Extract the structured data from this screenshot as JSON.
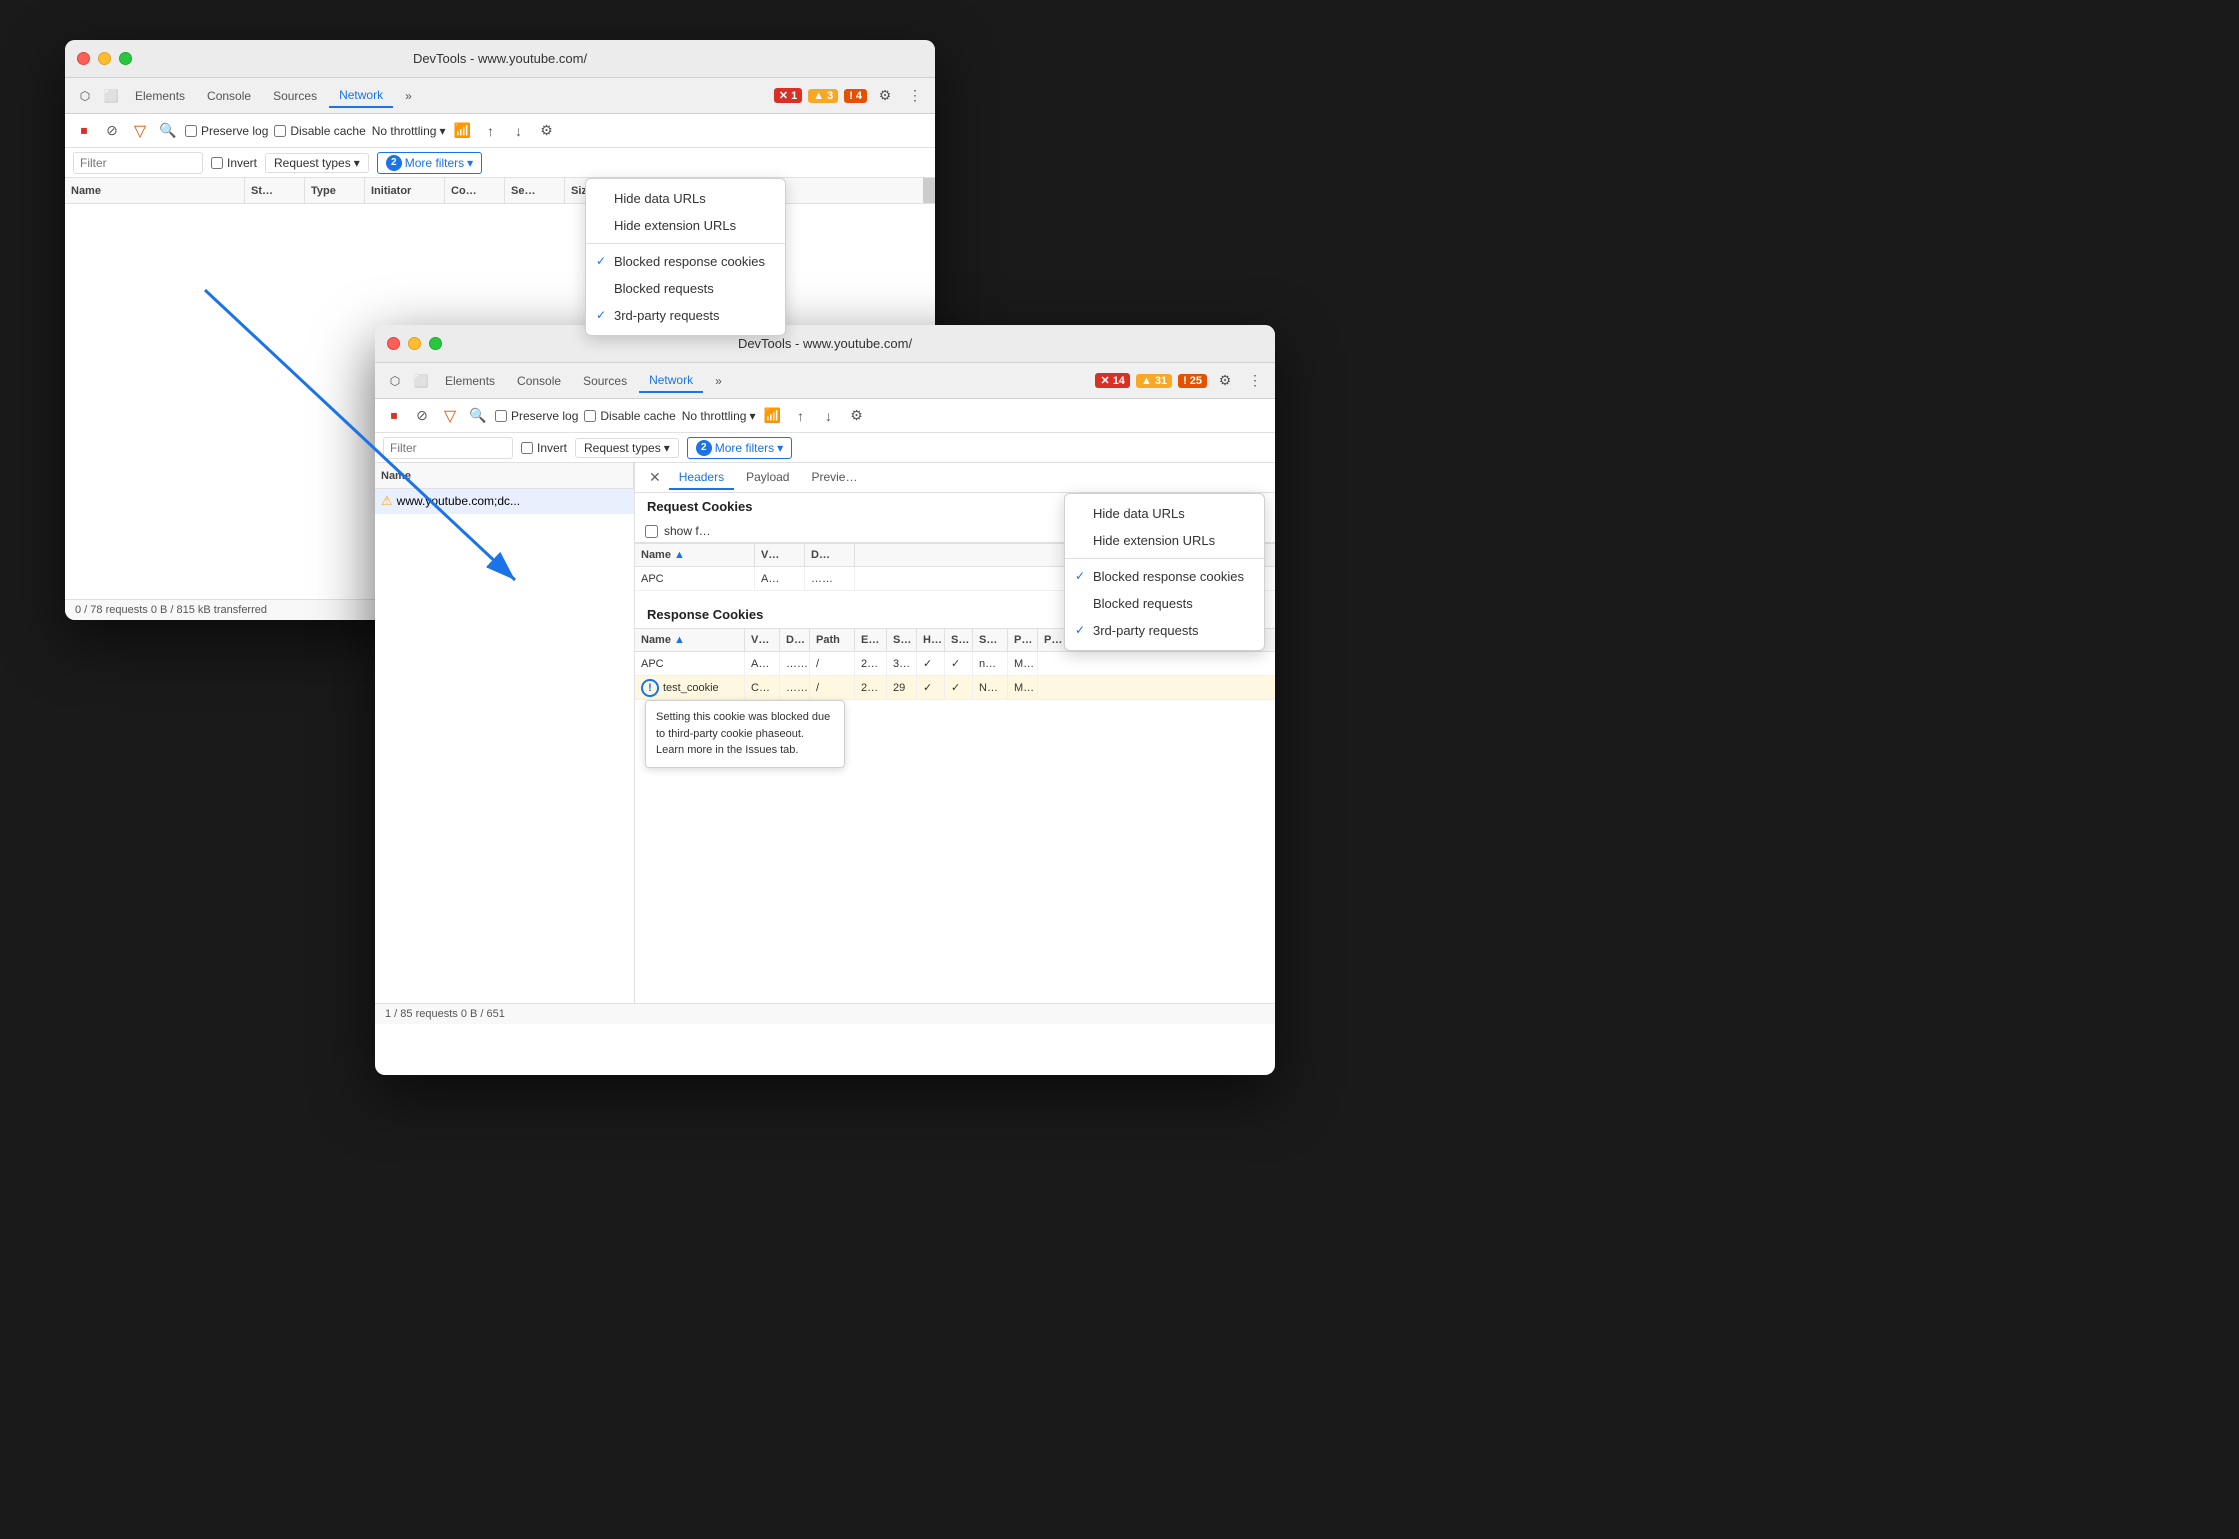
{
  "window1": {
    "title": "DevTools - www.youtube.com/",
    "tabs": [
      "Elements",
      "Console",
      "Sources",
      "Network",
      "»"
    ],
    "active_tab": "Network",
    "badges": [
      {
        "type": "red",
        "icon": "✕",
        "count": "1"
      },
      {
        "type": "yellow",
        "icon": "▲",
        "count": "3"
      },
      {
        "type": "orange",
        "icon": "!",
        "count": "4"
      }
    ],
    "toolbar": {
      "preserve_log": false,
      "disable_cache": false,
      "throttle": "No throttling"
    },
    "filter": {
      "placeholder": "Filter",
      "invert": false,
      "request_types": "Request types",
      "more_filters_count": "2",
      "more_filters": "More filters"
    },
    "table_headers": [
      "Name",
      "St…",
      "Type",
      "Initiator",
      "Co…",
      "Se…",
      "Siz…"
    ],
    "dropdown": {
      "items": [
        {
          "label": "Hide data URLs",
          "checked": false
        },
        {
          "label": "Hide extension URLs",
          "checked": false
        },
        {
          "divider": true
        },
        {
          "label": "Blocked response cookies",
          "checked": true
        },
        {
          "label": "Blocked requests",
          "checked": false
        },
        {
          "label": "3rd-party requests",
          "checked": true
        }
      ]
    },
    "status": "0 / 78 requests   0 B / 815 kB transferred"
  },
  "window2": {
    "title": "DevTools - www.youtube.com/",
    "tabs": [
      "Elements",
      "Console",
      "Sources",
      "Network",
      "»"
    ],
    "active_tab": "Network",
    "badges": [
      {
        "type": "red",
        "icon": "✕",
        "count": "14"
      },
      {
        "type": "yellow",
        "icon": "▲",
        "count": "31"
      },
      {
        "type": "orange",
        "icon": "!",
        "count": "25"
      }
    ],
    "toolbar": {
      "preserve_log": false,
      "disable_cache": false,
      "throttle": "No throttling"
    },
    "filter": {
      "placeholder": "Filter",
      "invert": false,
      "request_types": "Request types",
      "more_filters_count": "2",
      "more_filters": "More filters"
    },
    "table_col_name": "Name",
    "network_row": "www.youtube.com;dc...",
    "panel_tabs": [
      "✕",
      "Headers",
      "Payload",
      "Previe…"
    ],
    "active_panel_tab": "Headers",
    "request_cookies": {
      "title": "Request Cookies",
      "show_filter_label": "show f…",
      "headers": [
        "Name",
        "V…",
        "D…"
      ],
      "rows": [
        {
          "name": "APC",
          "v": "A…",
          "d": "……"
        }
      ]
    },
    "response_cookies": {
      "title": "Response Cookies",
      "headers": [
        "Name",
        "V…",
        "D…",
        "Path",
        "E…",
        "S…",
        "H…",
        "S…",
        "S…",
        "P…",
        "P…"
      ],
      "rows": [
        {
          "name": "APC",
          "v": "A…",
          "d": "……",
          "path": "/",
          "e": "2…",
          "s": "3…",
          "h": "✓",
          "s2": "✓",
          "s3": "n…",
          "p": "M…",
          "warn": false
        },
        {
          "name": "test_cookie",
          "v": "C…",
          "d": "……",
          "path": "/",
          "e": "2…",
          "s": "29",
          "h": "✓",
          "s2": "✓",
          "s3": "N…",
          "p": "M…",
          "warn": true
        }
      ]
    },
    "tooltip": "Setting this cookie was blocked due to third-party cookie phaseout. Learn more in the Issues tab.",
    "dropdown": {
      "items": [
        {
          "label": "Hide data URLs",
          "checked": false
        },
        {
          "label": "Hide extension URLs",
          "checked": false
        },
        {
          "divider": true
        },
        {
          "label": "Blocked response cookies",
          "checked": true
        },
        {
          "label": "Blocked requests",
          "checked": false
        },
        {
          "label": "3rd-party requests",
          "checked": true
        }
      ]
    },
    "status": "1 / 85 requests   0 B / 651"
  },
  "icons": {
    "stop": "⏹",
    "clear": "🚫",
    "filter": "▼",
    "search": "🔍",
    "upload": "↑",
    "download": "↓",
    "settings": "⚙",
    "more": "⋮",
    "chevron_down": "▾",
    "wifi": "⌘",
    "sort_asc": "▲"
  }
}
